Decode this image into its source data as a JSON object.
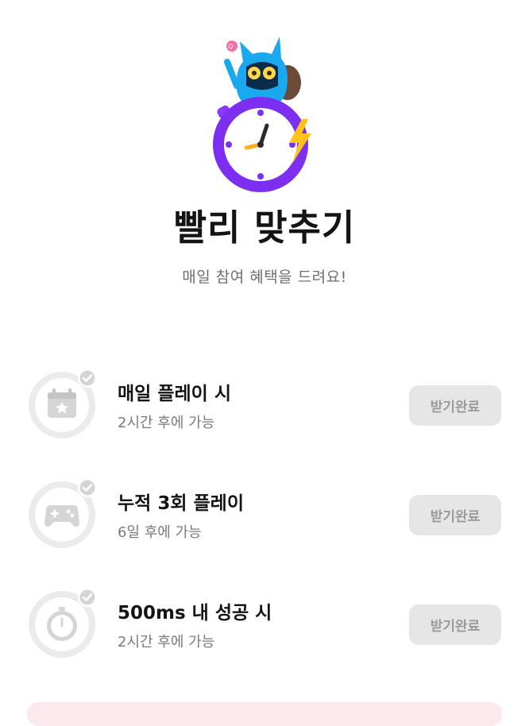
{
  "page": {
    "title": "빨리 맞추기",
    "subtitle": "매일 참여 혜택을 드려요!"
  },
  "rewards": [
    {
      "title": "매일 플레이 시",
      "subtitle": "2시간 후에 가능",
      "button_label": "받기완료",
      "icon": "calendar-star-icon",
      "completed": true
    },
    {
      "title": "누적 3회 플레이",
      "subtitle": "6일 후에 가능",
      "button_label": "받기완료",
      "icon": "gamepad-icon",
      "completed": true
    },
    {
      "title": "500ms 내 성공 시",
      "subtitle": "2시간 후에 가능",
      "button_label": "받기완료",
      "icon": "stopwatch-icon",
      "completed": true
    }
  ],
  "colors": {
    "icon_gray": "#d9d9d9",
    "button_bg": "#e6e6e6",
    "button_text": "#9b9b9b",
    "stopwatch_purple": "#7c2ff0",
    "mascot_blue": "#1aa8ef",
    "bolt_yellow": "#ffc21a"
  }
}
